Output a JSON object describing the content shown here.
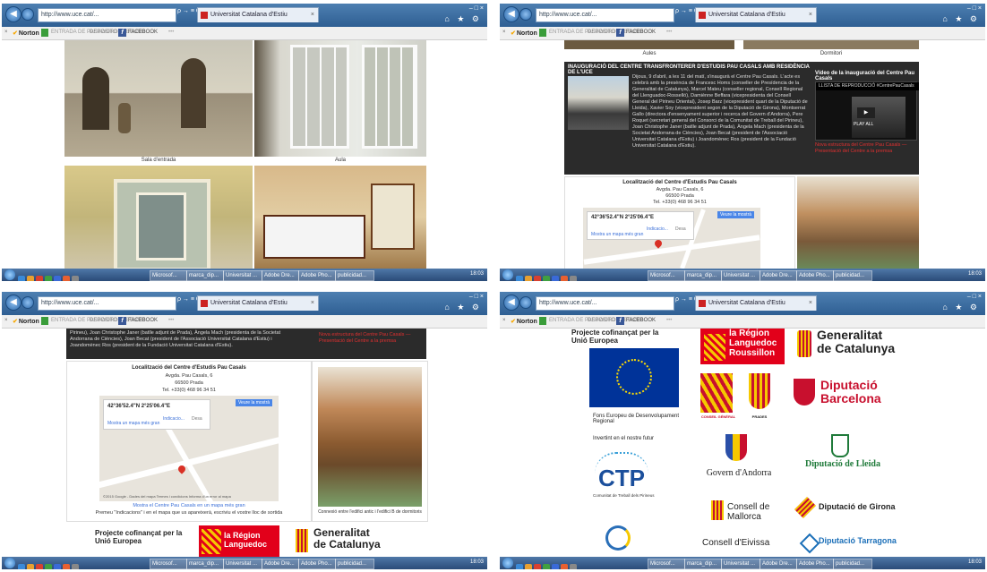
{
  "browser": {
    "address": "http://www.uce.cat/...",
    "address_controls": "ρ → ≡ C ×",
    "tab_title": "Universitat Catalana d'Estiu",
    "tab_close": "×",
    "window_controls": "– □ ×",
    "right_icons": "⌂ ★ ⚙",
    "toolbar": {
      "close": "×",
      "norton": "Norton",
      "safe_search": "ENTRADA DE PASSWORD / SEGURO",
      "deposit": "DEPOSITO",
      "facebook": "FACEBOOK",
      "dots": "•••"
    }
  },
  "taskbar": {
    "items": [
      "Microsof...",
      "marca_dip...",
      "Universitat ...",
      "Adobe Dre...",
      "Adobe Pho...",
      "publicidad..."
    ],
    "clock": "18:03"
  },
  "q1": {
    "captions": [
      "Sala d'entrada",
      "Aula"
    ]
  },
  "q2": {
    "top_captions": [
      "Aules",
      "Dormitori"
    ],
    "heading": "INAUGURACIÓ DEL CENTRE TRANSFRONTERER D'ESTUDIS PAU CASALS AMB RESIDÈNCIA DE L'UCE",
    "paragraph": "Dijous, 9 d'abril, a les 11 del matí, s'inaugurà el Centre Pau Casals. L'acte es celebrà amb la presència de Francesc Homs (conseller de Presídencia de la Generalitat de Catalunya), Marcel Mateu (conseller regional, Consell Regional del Llenguadoc-Rosselló), Damiènne Beffara (vicepresidenta del Consell General del Pirineu Oriental), Josep Barz (vicepresident quart de la Diputació de Lleida), Xavier Soy (vicepresident segon de la Diputació de Girona), Montserrat Gallo (directora d'ensenyament superior i recerca del Govern d'Andorra), Pere Roquet (secretari general del Consorci de la Comunitat de Treball del Pirineu), Joan Christophe Janer (batlle adjunt de Prada), Àngela Mach (presidenta de la Societat Andorrana de Ciències), Joan Becat (president de l'Associació Universitat Catalana d'Estiu) i Joandomènec Ros (president de la Fundació Universitat Catalana d'Estiu).",
    "video_title": "Vídeo de la inauguració del Centre Pau Casals",
    "video_bar": "LLISTA DE REPRODUCCIÓ #CentrePauCasals",
    "video_play": "PLAY ALL",
    "red_links": "Nova estructura del Centre Pau Casals — Presentació del Centre a la premsa"
  },
  "location": {
    "title": "Localització del Centre d'Estudis Pau Casals",
    "address1": "Avgda. Pau Casals, 6",
    "address2": "66500 Prada",
    "phone": "Tel. +33(0) 468 96 34 51",
    "coords": "42°36'52.4\"N 2°25'06.4\"E",
    "open_map": "Veure la mostrà",
    "directions": "Indicacio...",
    "save": "Desa",
    "larger_map": "Mostra un mapa més gran",
    "map_credit": "©2015 Google - Dades del mapa  Termes i condicions  Informa d'un error al mapa",
    "map_link": "Mostra el Centre Pau Casals en un mapa més gran",
    "hint": "Premeu \"Indicacions\" i en el mapa que us apareixerà, escriviu el vostre lloc de sortida",
    "photo_caption": "Connexió entre l'edifici antic i l'edifici B de dormitoris"
  },
  "logos": {
    "eu_text": "Projecte cofinançat per la Unió Europea",
    "feder": "Fons Europeu de Desenvolupament Regional",
    "future": "Invertint en el nostre futur",
    "region1": "la Région",
    "region2": "Languedoc",
    "region3": "Roussillon",
    "gen1": "Generalitat",
    "gen2": "de Catalunya",
    "dip_bcn1": "Diputació",
    "dip_bcn2": "Barcelona",
    "conseil": "CONSEIL GÉNÉRAL",
    "prades": "PRADES",
    "andorra": "Govern d'Andorra",
    "lleida": "Diputació de Lleida",
    "ctp": "CTP",
    "ctp_small": "Comunitat de Treball dels Pirineus",
    "mallorca1": "Consell de",
    "mallorca2": "Mallorca",
    "girona": "Diputació de Girona",
    "eivissa": "Consell d'Eivissa",
    "tarragona": "Diputació Tarragona"
  },
  "colors": {
    "titlebar": "#3a6b9e",
    "dark_block": "#2b2b2b",
    "eu_blue": "#003399",
    "region_red": "#e2001a",
    "diputacio_red": "#c8102e",
    "lleida_green": "#1f7a3a"
  }
}
